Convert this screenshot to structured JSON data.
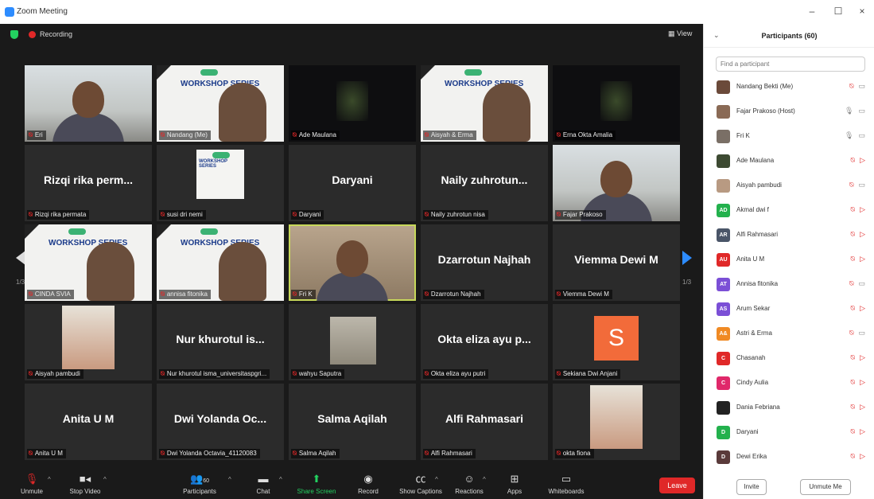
{
  "window": {
    "title": "Zoom Meeting",
    "minimize": "–",
    "maximize": "☐",
    "close": "×"
  },
  "meeting": {
    "recording_label": "Recording",
    "view_label": "View",
    "page_left": "1/3",
    "page_right": "1/3",
    "tiles": [
      {
        "label": "Eri",
        "center": "",
        "kind": "person"
      },
      {
        "label": "Nandang (Me)",
        "center": "",
        "kind": "banner"
      },
      {
        "label": "Ade Maulana",
        "center": "",
        "kind": "dark"
      },
      {
        "label": "Aisyah & Erma",
        "center": "",
        "kind": "banner"
      },
      {
        "label": "Erna Okta Amalia",
        "center": "",
        "kind": "dark"
      },
      {
        "label": "Rizqi rika permata",
        "center": "Rizqi rika perm...",
        "kind": "text"
      },
      {
        "label": "susi dri nemi",
        "center": "",
        "kind": "banner-small"
      },
      {
        "label": "Daryani",
        "center": "Daryani",
        "kind": "text"
      },
      {
        "label": "Naily zuhrotun nisa",
        "center": "Naily zuhrotun...",
        "kind": "text"
      },
      {
        "label": "Fajar Prakoso",
        "center": "",
        "kind": "person"
      },
      {
        "label": "CINDA SVIA",
        "center": "",
        "kind": "banner"
      },
      {
        "label": "annisa fitonika",
        "center": "",
        "kind": "banner"
      },
      {
        "label": "Fri K",
        "center": "",
        "kind": "person-active"
      },
      {
        "label": "Dzarrotun Najhah",
        "center": "Dzarrotun Najhah",
        "kind": "text"
      },
      {
        "label": "Viemma Dewi M",
        "center": "Viemma Dewi M",
        "kind": "text"
      },
      {
        "label": "Aisyah pambudi",
        "center": "",
        "kind": "person-small"
      },
      {
        "label": "Nur khurotul isma_universitaspgri...",
        "center": "Nur khurotul is...",
        "kind": "text"
      },
      {
        "label": "wahyu Saputra",
        "center": "",
        "kind": "ground"
      },
      {
        "label": "Okta eliza ayu putri",
        "center": "Okta eliza ayu p...",
        "kind": "text"
      },
      {
        "label": "Sekiana Dwi Anjani",
        "center": "",
        "kind": "avatar-s"
      },
      {
        "label": "Anita U M",
        "center": "Anita U M",
        "kind": "text"
      },
      {
        "label": "Dwi Yolanda Octavia_41120083",
        "center": "Dwi Yolanda Oc...",
        "kind": "text"
      },
      {
        "label": "Salma Aqilah",
        "center": "Salma Aqilah",
        "kind": "text"
      },
      {
        "label": "Alfi Rahmasari",
        "center": "Alfi Rahmasari",
        "kind": "text"
      },
      {
        "label": "okta fiona",
        "center": "",
        "kind": "person-small"
      }
    ],
    "banner_text": "WORKSHOP SERIES",
    "avatar_letter": "S"
  },
  "toolbar": {
    "unmute": "Unmute",
    "stop_video": "Stop Video",
    "participants": "Participants",
    "participants_count": "60",
    "chat": "Chat",
    "share_screen": "Share Screen",
    "record": "Record",
    "show_captions": "Show Captions",
    "reactions": "Reactions",
    "apps": "Apps",
    "whiteboards": "Whiteboards",
    "leave": "Leave"
  },
  "panel": {
    "title": "Participants (60)",
    "search_placeholder": "Find a participant",
    "participants": [
      {
        "name": "Nandang Bekti (Me)",
        "initials": "",
        "color": "#6b4a3a",
        "mic": "muted",
        "video": "off"
      },
      {
        "name": "Fajar Prakoso (Host)",
        "initials": "",
        "color": "#8a6a55",
        "mic": "on",
        "video": "off"
      },
      {
        "name": "Fri K",
        "initials": "",
        "color": "#7a6f66",
        "mic": "on",
        "video": "off"
      },
      {
        "name": "Ade Maulana",
        "initials": "",
        "color": "#3d4a32",
        "mic": "muted",
        "video": "muted"
      },
      {
        "name": "Aisyah pambudi",
        "initials": "",
        "color": "#b89a82",
        "mic": "muted",
        "video": "off"
      },
      {
        "name": "Akmal dwi f",
        "initials": "AD",
        "color": "#23b14d",
        "mic": "muted",
        "video": "muted"
      },
      {
        "name": "Alfi Rahmasari",
        "initials": "AR",
        "color": "#4a5568",
        "mic": "muted",
        "video": "muted"
      },
      {
        "name": "Anita U M",
        "initials": "AU",
        "color": "#e02828",
        "mic": "muted",
        "video": "muted"
      },
      {
        "name": "Annisa fitonika",
        "initials": "AT",
        "color": "#7b4fd6",
        "mic": "muted",
        "video": "off"
      },
      {
        "name": "Arum Sekar",
        "initials": "AS",
        "color": "#7b4fd6",
        "mic": "muted",
        "video": "muted"
      },
      {
        "name": "Astri & Erma",
        "initials": "A&",
        "color": "#f08a24",
        "mic": "muted",
        "video": "off"
      },
      {
        "name": "Chasanah",
        "initials": "C",
        "color": "#e02828",
        "mic": "muted",
        "video": "muted"
      },
      {
        "name": "Cindy Aulia",
        "initials": "C",
        "color": "#e0286a",
        "mic": "muted",
        "video": "muted"
      },
      {
        "name": "Dania Febriana",
        "initials": "",
        "color": "#222222",
        "mic": "muted",
        "video": "muted"
      },
      {
        "name": "Daryani",
        "initials": "D",
        "color": "#23b14d",
        "mic": "muted",
        "video": "muted"
      },
      {
        "name": "Dewi Erika",
        "initials": "D",
        "color": "#5a3a3a",
        "mic": "muted",
        "video": "muted"
      }
    ],
    "invite": "Invite",
    "unmute_me": "Unmute Me"
  }
}
